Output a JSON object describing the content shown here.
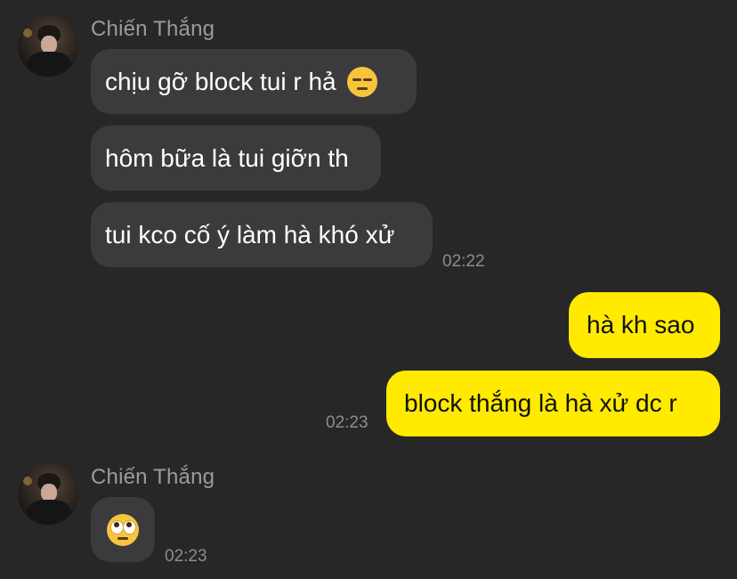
{
  "groups": [
    {
      "sender": "Chiến Thắng",
      "messages": [
        {
          "text": "chịu gỡ block tui r hả",
          "emoji": "pensive-face"
        },
        {
          "text": "hôm bữa là tui giỡn th"
        },
        {
          "text": "tui kco cố ý làm hà khó xử"
        }
      ],
      "time": "02:22"
    },
    {
      "sender": "me",
      "messages": [
        {
          "text": "hà kh sao"
        },
        {
          "text": "block thắng là hà xử dc r"
        }
      ],
      "time": "02:23"
    },
    {
      "sender": "Chiến Thắng",
      "messages": [
        {
          "emoji": "face-with-rolling-eyes"
        }
      ],
      "time": "02:23"
    }
  ],
  "colors": {
    "background": "#272727",
    "incoming_bubble": "#3b3b3d",
    "outgoing_bubble": "#ffea00",
    "sender_name": "#9b9b9b",
    "timestamp": "#8d8d8d"
  }
}
